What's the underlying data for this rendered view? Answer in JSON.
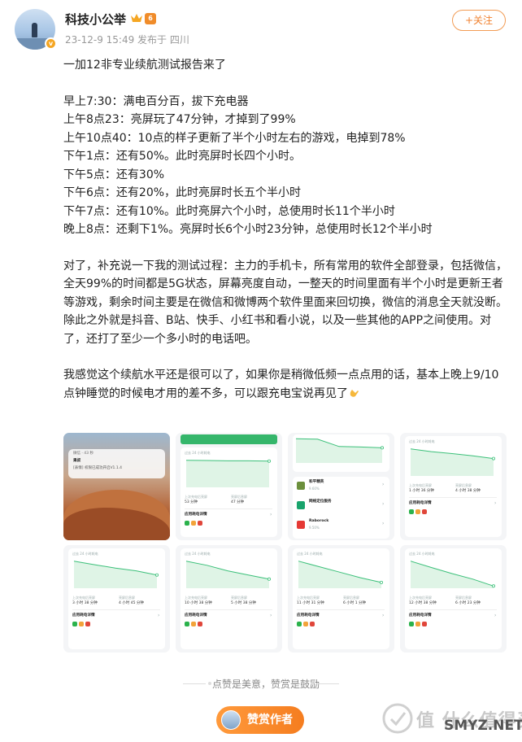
{
  "post": {
    "author_name": "科技小公举",
    "level_badge": "6",
    "meta": "23-12-9 15:49 发布于 四川",
    "follow_label": "+关注"
  },
  "body": {
    "title": "一加12非专业续航测试报告来了",
    "log": [
      "早上7:30：满电百分百，拔下充电器",
      "上午8点23：亮屏玩了47分钟，才掉到了99%",
      "上午10点40：10点的样子更新了半个小时左右的游戏，电掉到78%",
      "下午1点：还有50%。此时亮屏时长四个小时。",
      "下午5点：还有30%",
      "下午6点：还有20%，此时亮屏时长五个半小时",
      "下午7点：还有10%。此时亮屏六个小时，总使用时长11个半小时",
      "晚上8点：还剩下1%。亮屏时长6个小时23分钟，总使用时长12个半小时"
    ],
    "para1": "对了，补充说一下我的测试过程：主力的手机卡，所有常用的软件全部登录，包括微信，全天99%的时间都是5G状态，屏幕亮度自动，一整天的时间里面有半个小时是更新王者等游戏，剩余时间主要是在微信和微博两个软件里面来回切换，微信的消息全天就没断。除此之外就是抖音、B站、快手、小红书和看小说，以及一些其他的APP之间使用。对了，还打了至少一个多小时的电话吧。",
    "para2": "我感觉这个续航水平还是很可以了，如果你是稍微低频一点点用的话，基本上晚上9/10点钟睡觉的时候电才用的差不多，可以跟充电宝说再见了"
  },
  "shots": [
    {
      "kind": "lock",
      "notif_app": "微信 · 43 秒",
      "notif_title": "果叔",
      "notif_text": "[表情] 权限已成功开启V1.1.4"
    },
    {
      "kind": "top",
      "section": "过去 24 小时耗电",
      "stat1_label": "上次充电后亮屏",
      "stat1": "53 分钟",
      "stat2_label": "亮屏后息屏",
      "stat2": "47 分钟",
      "footer": "应用耗电详情",
      "curve": [
        0.95,
        0.94,
        0.93,
        0.93,
        0.92
      ]
    },
    {
      "kind": "apps",
      "rows": [
        {
          "name": "和平精英",
          "pct": "9.60%",
          "color": "#6b8f3c"
        },
        {
          "name": "网络定位服务",
          "pct": "",
          "color": "#18a36c"
        },
        {
          "name": "Raborock",
          "pct": "9.50%",
          "color": "#e53935"
        }
      ]
    },
    {
      "kind": "mid",
      "section": "过去 24 小时耗电",
      "stat1_label": "上次充电后亮屏",
      "stat1": "1 小时 36 分钟",
      "stat2_label": "亮屏后息屏",
      "stat2": "4 小时 38 分钟",
      "footer": "应用耗电详情",
      "curve": [
        0.95,
        0.85,
        0.78,
        0.7,
        0.6
      ]
    },
    {
      "kind": "mid",
      "section": "过去 24 小时耗电",
      "stat1_label": "上次充电后亮屏",
      "stat1": "3 小时 38 分钟",
      "stat2_label": "亮屏后息屏",
      "stat2": "4 小时 45 分钟",
      "footer": "应用耗电详情",
      "curve": [
        0.95,
        0.82,
        0.7,
        0.6,
        0.45
      ]
    },
    {
      "kind": "mid",
      "section": "过去 24 小时耗电",
      "stat1_label": "上次充电后亮屏",
      "stat1": "10 小时 38 分钟",
      "stat2_label": "亮屏后息屏",
      "stat2": "5 小时 38 分钟",
      "footer": "应用耗电详情",
      "curve": [
        0.95,
        0.8,
        0.6,
        0.45,
        0.3
      ]
    },
    {
      "kind": "mid",
      "section": "过去 24 小时耗电",
      "stat1_label": "上次充电后亮屏",
      "stat1": "11 小时 31 分钟",
      "stat2_label": "亮屏后息屏",
      "stat2": "6 小时 1 分钟",
      "footer": "应用耗电详情",
      "curve": [
        0.95,
        0.75,
        0.55,
        0.35,
        0.18
      ]
    },
    {
      "kind": "mid",
      "section": "过去 24 小时耗电",
      "stat1_label": "上次充电后亮屏",
      "stat1": "12 小时 38 分钟",
      "stat2_label": "亮屏后息屏",
      "stat2": "6 小时 23 分钟",
      "footer": "应用耗电详情",
      "curve": [
        0.95,
        0.72,
        0.5,
        0.3,
        0.05
      ]
    }
  ],
  "footer": {
    "tagline": "点赞是美意，赞赏是鼓励",
    "reward_label": "赞赏作者"
  },
  "watermark": {
    "text": "值 什么值得买",
    "site": "SMYZ.NET"
  },
  "colors": {
    "accent": "#f0812f",
    "chart_green": "#3cc07a"
  }
}
